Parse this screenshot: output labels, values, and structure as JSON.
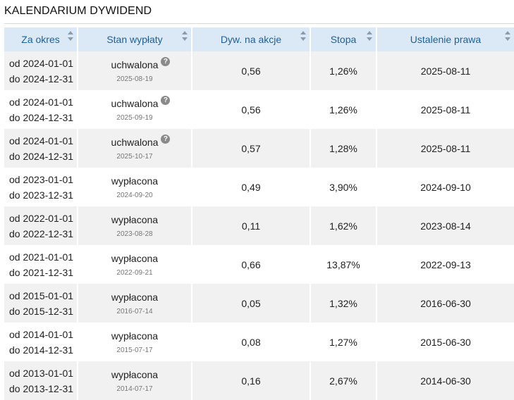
{
  "title": "KALENDARIUM DYWIDEND",
  "columns": [
    "Za okres",
    "Stan wypłaty",
    "Dyw. na akcje",
    "Stopa",
    "Ustalenie prawa"
  ],
  "rows": [
    {
      "from": "od 2024-01-01",
      "to": "do 2024-12-31",
      "status": "uchwalona",
      "status_date": "2025-08-19",
      "help": "?",
      "dividend": "0,56",
      "yield": "1,26%",
      "record_date": "2025-08-11"
    },
    {
      "from": "od 2024-01-01",
      "to": "do 2024-12-31",
      "status": "uchwalona",
      "status_date": "2025-09-19",
      "help": "?",
      "dividend": "0,56",
      "yield": "1,26%",
      "record_date": "2025-08-11"
    },
    {
      "from": "od 2024-01-01",
      "to": "do 2024-12-31",
      "status": "uchwalona",
      "status_date": "2025-10-17",
      "help": "?",
      "dividend": "0,57",
      "yield": "1,28%",
      "record_date": "2025-08-11"
    },
    {
      "from": "od 2023-01-01",
      "to": "do 2023-12-31",
      "status": "wypłacona",
      "status_date": "2024-09-20",
      "help": "",
      "dividend": "0,49",
      "yield": "3,90%",
      "record_date": "2024-09-10"
    },
    {
      "from": "od 2022-01-01",
      "to": "do 2022-12-31",
      "status": "wypłacona",
      "status_date": "2023-08-28",
      "help": "",
      "dividend": "0,11",
      "yield": "1,62%",
      "record_date": "2023-08-14"
    },
    {
      "from": "od 2021-01-01",
      "to": "do 2021-12-31",
      "status": "wypłacona",
      "status_date": "2022-09-21",
      "help": "",
      "dividend": "0,66",
      "yield": "13,87%",
      "record_date": "2022-09-13"
    },
    {
      "from": "od 2015-01-01",
      "to": "do 2015-12-31",
      "status": "wypłacona",
      "status_date": "2016-07-14",
      "help": "",
      "dividend": "0,05",
      "yield": "1,32%",
      "record_date": "2016-06-30"
    },
    {
      "from": "od 2014-01-01",
      "to": "do 2014-12-31",
      "status": "wypłacona",
      "status_date": "2015-07-17",
      "help": "",
      "dividend": "0,08",
      "yield": "1,27%",
      "record_date": "2015-06-30"
    },
    {
      "from": "od 2013-01-01",
      "to": "do 2013-12-31",
      "status": "wypłacona",
      "status_date": "2014-07-17",
      "help": "",
      "dividend": "0,16",
      "yield": "2,67%",
      "record_date": "2014-06-30"
    }
  ]
}
